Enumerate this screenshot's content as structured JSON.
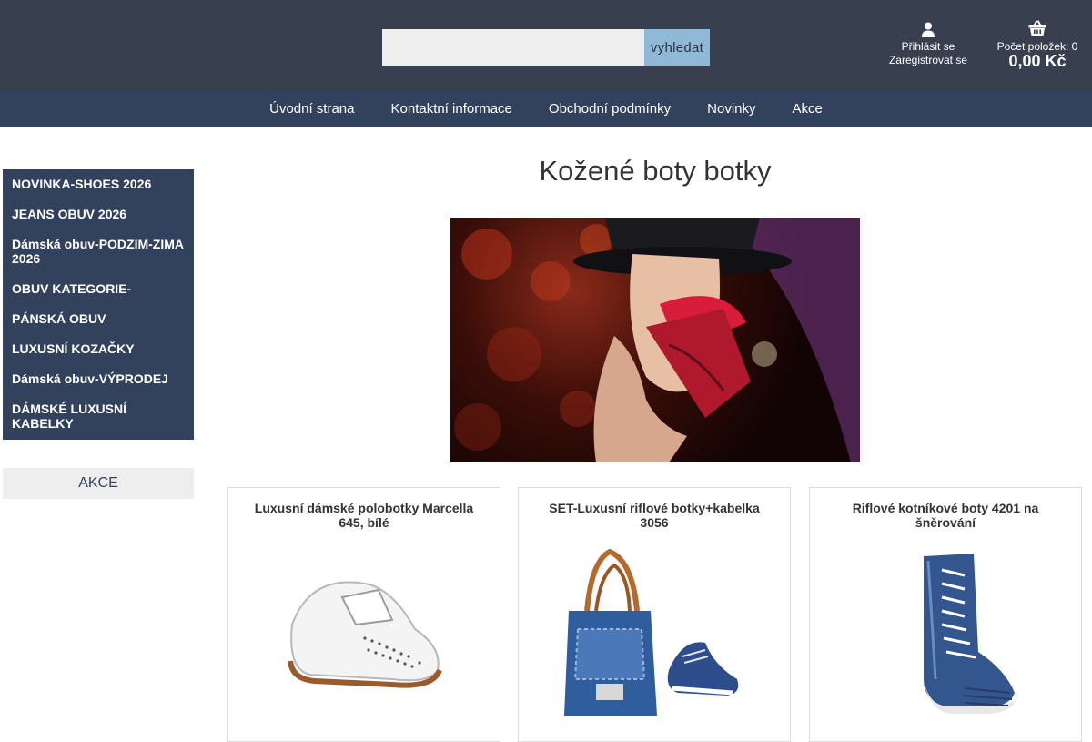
{
  "header": {
    "search": {
      "placeholder": "",
      "button_label": "vyhledat"
    },
    "account": {
      "login_label": "Přihlásit se",
      "register_label": "Zaregistrovat se",
      "icon": "user-icon"
    },
    "cart": {
      "count_label": "Počet položek: 0",
      "total": "0,00 Kč",
      "icon": "basket-icon"
    }
  },
  "nav": {
    "items": [
      {
        "label": "Úvodní strana"
      },
      {
        "label": "Kontaktní informace"
      },
      {
        "label": "Obchodní podmínky"
      },
      {
        "label": "Novinky"
      },
      {
        "label": "Akce"
      }
    ]
  },
  "sidebar": {
    "categories": [
      {
        "label": "NOVINKA-SHOES 2026"
      },
      {
        "label": "JEANS OBUV 2026"
      },
      {
        "label": "Dámská obuv-PODZIM-ZIMA 2026"
      },
      {
        "label": "OBUV KATEGORIE-"
      },
      {
        "label": "PÁNSKÁ OBUV"
      },
      {
        "label": "LUXUSNÍ KOZAČKY"
      },
      {
        "label": "Dámská obuv-VÝPRODEJ"
      },
      {
        "label": "DÁMSKÉ LUXUSNÍ KABELKY"
      }
    ],
    "akce_label": "AKCE"
  },
  "main": {
    "title": "Kožené boty botky",
    "products": [
      {
        "name": "Luxusní dámské polobotky Marcella 645, bílé"
      },
      {
        "name": "SET-Luxusní riflové botky+kabelka 3056"
      },
      {
        "name": "Riflové kotníkové boty 4201 na šněrování"
      }
    ]
  },
  "colors": {
    "header_bg": "#383f4f",
    "nav_bg": "#33425c",
    "search_button_bg": "#8fb9d6"
  }
}
